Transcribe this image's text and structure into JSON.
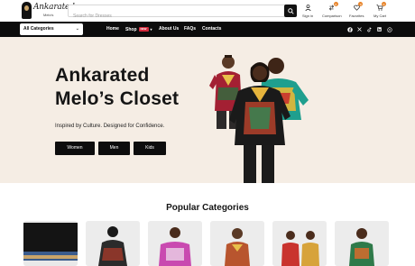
{
  "header": {
    "logo_text": "Ankarated",
    "logo_sub": "Melo's",
    "search": {
      "placeholder": "Search for Dresses"
    },
    "actions": [
      {
        "label": "Sign in",
        "icon": "user-icon"
      },
      {
        "label": "Comparison",
        "icon": "compare-icon",
        "badge": "0"
      },
      {
        "label": "Favorites",
        "icon": "heart-icon",
        "badge": "0"
      },
      {
        "label": "My Cart",
        "icon": "cart-icon",
        "badge": "0"
      }
    ]
  },
  "nav": {
    "category_select": "All Categories",
    "links": [
      "Home",
      "Shop",
      "About Us",
      "FAQs",
      "Contacts"
    ],
    "shop_badge": "NEW",
    "social": [
      "facebook-icon",
      "x-icon",
      "tiktok-icon",
      "linkedin-icon",
      "whatsapp-icon"
    ]
  },
  "hero": {
    "title_line1": "Ankarated",
    "title_line2": "Melo’s Closet",
    "subtitle": "Inspired by Culture. Designed for Confidence.",
    "buttons": [
      "Women",
      "Men",
      "Kids"
    ]
  },
  "categories": {
    "title": "Popular Categories"
  },
  "colors": {
    "accent": "#e8852c",
    "nav_bg": "#0c0c0c",
    "hero_bg": "#f5ede4",
    "badge_red": "#d32a3c"
  }
}
